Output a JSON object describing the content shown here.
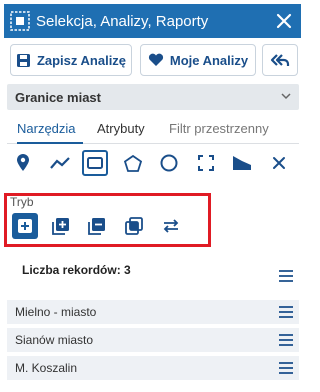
{
  "panel": {
    "title": "Selekcja, Analizy, Raporty",
    "accent": "#1f6fb2"
  },
  "toolbar": {
    "save_label": "Zapisz Analizę",
    "my_analyses_label": "Moje Analizy",
    "back_icon": "undo-arrow-icon"
  },
  "layer_select": {
    "value": "Granice miast"
  },
  "tabs": [
    {
      "label": "Narzędzia",
      "active": true
    },
    {
      "label": "Atrybuty",
      "active": false
    },
    {
      "label": "Filtr przestrzenny",
      "active": false
    }
  ],
  "tools": [
    "point-icon",
    "polyline-icon",
    "rectangle-icon",
    "polygon-icon",
    "circle-icon",
    "extent-icon",
    "layer-shape-icon",
    "clear-icon"
  ],
  "mode": {
    "label": "Tryb",
    "buttons": [
      "new-selection-icon",
      "add-selection-icon",
      "remove-selection-icon",
      "intersect-selection-icon",
      "switch-selection-icon"
    ]
  },
  "records": {
    "label": "Liczba rekordów: 3"
  },
  "items": [
    {
      "label": "Mielno - miasto"
    },
    {
      "label": "Sianów miasto"
    },
    {
      "label": "M. Koszalin"
    }
  ]
}
